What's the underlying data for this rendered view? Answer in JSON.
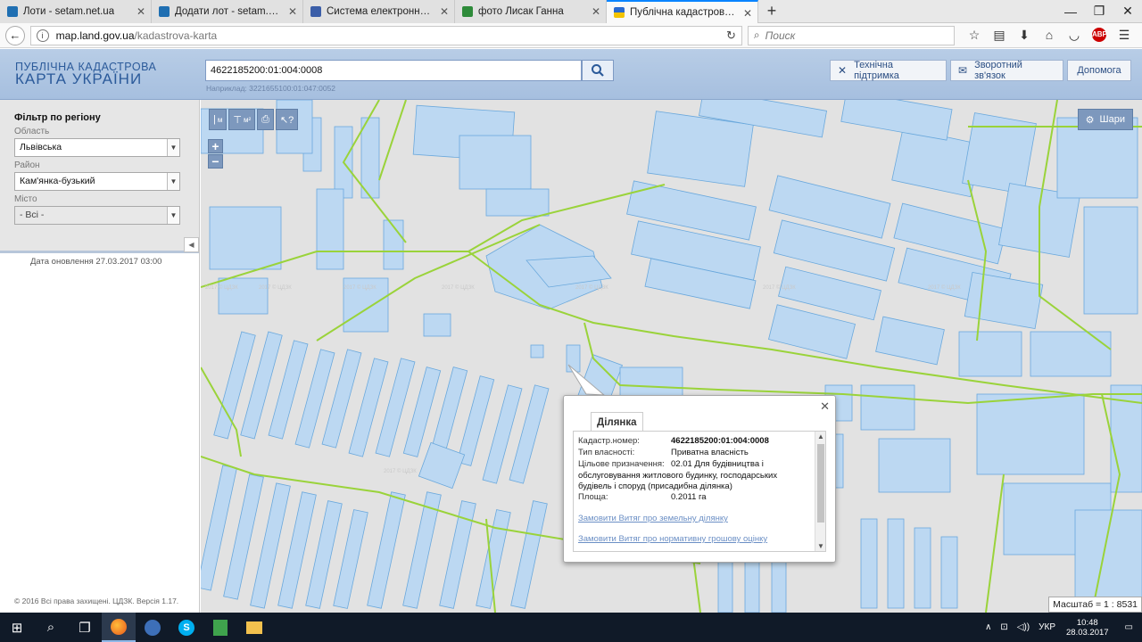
{
  "browser": {
    "tabs": [
      {
        "label": "Лоти - setam.net.ua",
        "icon_color": "#1f6fb2"
      },
      {
        "label": "Додати лот - setam.net.ua",
        "icon_color": "#1f6fb2"
      },
      {
        "label": "Система електронної по...",
        "icon_color": "#3b5ea8"
      },
      {
        "label": "фото Лисак Ганна",
        "icon_color": "#2e8b3a"
      },
      {
        "label": "Публічна кадастрова кар...",
        "icon_color": "#e0b000"
      }
    ],
    "url_host": "map.land.gov.ua",
    "url_path": "/kadastrova-karta",
    "search_placeholder": "Поиск",
    "abp_label": "ABP"
  },
  "header": {
    "logo_line1": "ПУБЛІЧНА КАДАСТРОВА",
    "logo_line2": "КАРТА УКРАЇНИ",
    "search_value": "4622185200:01:004:0008",
    "search_example": "Наприклад: 3221655100:01:047:0052",
    "btn_support": "Технічна підтримка",
    "btn_feedback": "Зворотний зв'язок",
    "btn_help": "Допомога"
  },
  "sidebar": {
    "title": "Фільтр по регіону",
    "oblast_label": "Область",
    "oblast_value": "Львівська",
    "rayon_label": "Район",
    "rayon_value": "Кам'янка-бузький",
    "misto_label": "Місто",
    "misto_value": "- Всі -",
    "update_date": "Дата оновлення  27.03.2017 03:00",
    "copyright": "© 2016 Всі права захищені. ЦДЗК. Версія 1.17."
  },
  "map": {
    "tool_ruler": "м",
    "tool_area": "м²",
    "layers_label": "Шари",
    "scale": "Масштаб = 1 : 8531",
    "watermark": "2017 © ЦДЗК",
    "colors": {
      "parcel_fill": "#bcd8f2",
      "parcel_stroke": "#6aa8dc",
      "boundary": "#9ad33a",
      "background": "#e2e2e2"
    }
  },
  "popup": {
    "tab": "Ділянка",
    "cadastr_label": "Кадастр.номер:",
    "cadastr_value": "4622185200:01:004:0008",
    "ownership_label": "Тип власності:",
    "ownership_value": "Приватна власність",
    "purpose_label": "Цільове призначення:",
    "purpose_code": "02.01 Для будівництва і",
    "purpose_text": "обслуговування житлового будинку, господарських будівель і споруд (присадибна ділянка)",
    "area_label": "Площа:",
    "area_value": "0.2011 га",
    "link1": "Замовити Витяг про земельну ділянку",
    "link2": "Замовити Витяг про нормативну грошову оцінку"
  },
  "taskbar": {
    "lang": "УКР",
    "time": "10:48",
    "date": "28.03.2017"
  }
}
